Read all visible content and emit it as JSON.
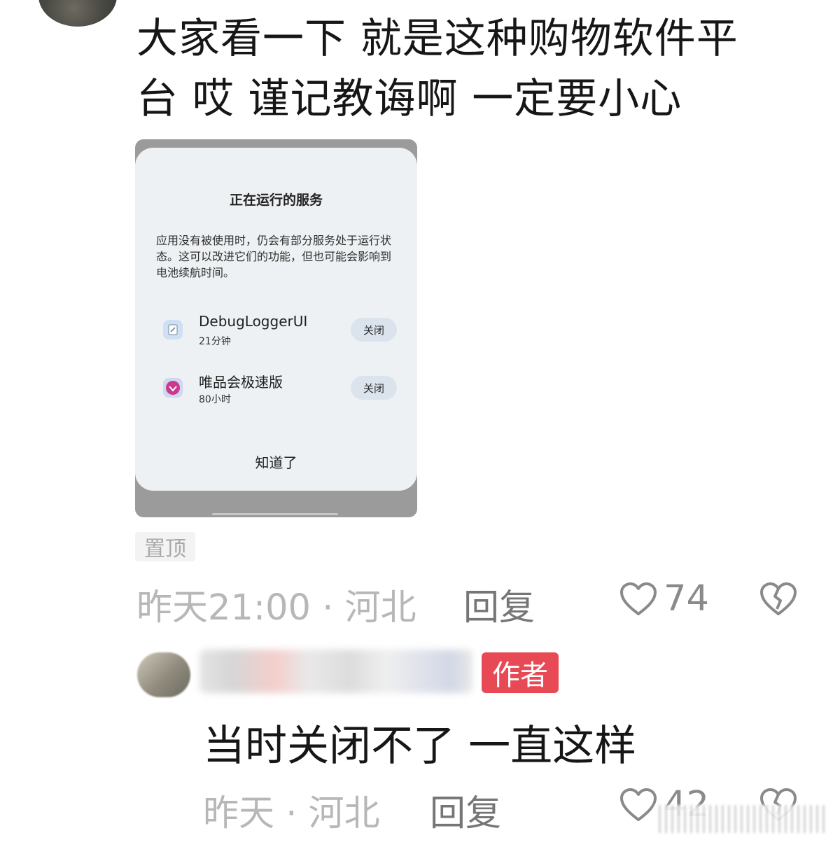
{
  "post": {
    "comment_line1": "大家看一下 就是这种购物软件平",
    "comment_line2": "台 哎 谨记教诲啊 一定要小心"
  },
  "screenshot": {
    "title": "正在运行的服务",
    "description": "应用没有被使用时，仍会有部分服务处于运行状态。这可以改进它们的功能，但也可能会影响到电池续航时间。",
    "services": [
      {
        "name": "DebugLoggerUI",
        "time": "21分钟",
        "close_label": "关闭",
        "icon": "debug-logger-icon"
      },
      {
        "name": "唯品会极速版",
        "time": "80小时",
        "close_label": "关闭",
        "icon": "vipshop-icon"
      }
    ],
    "ok_label": "知道了"
  },
  "pin_label": "置顶",
  "comment_meta": {
    "time_location": "昨天21:00 · 河北",
    "reply_label": "回复",
    "like_count": "74",
    "like_icon": "heart-outline-icon",
    "dislike_icon": "broken-heart-icon"
  },
  "reply": {
    "author_badge": "作者",
    "text": "当时关闭不了 一直这样",
    "time_location": "昨天 · 河北",
    "reply_label": "回复",
    "like_count": "42"
  },
  "colors": {
    "badge": "#e84a55",
    "meta_text": "#b7b7b7",
    "reply_text": "#767676"
  }
}
